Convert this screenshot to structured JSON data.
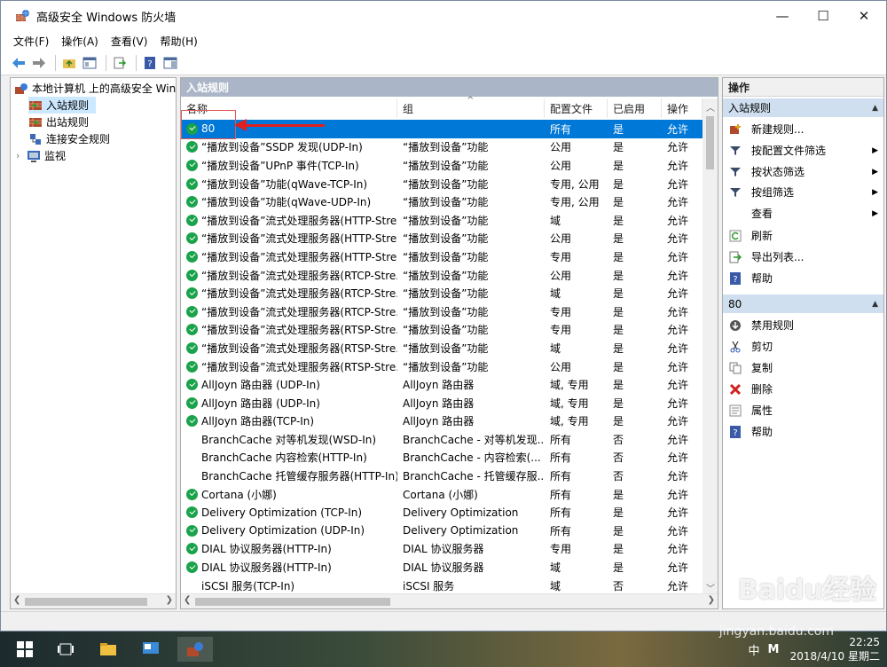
{
  "window": {
    "title": "高级安全 Windows 防火墙",
    "min": "—",
    "max": "☐",
    "close": "✕"
  },
  "menu": [
    "文件(F)",
    "操作(A)",
    "查看(V)",
    "帮助(H)"
  ],
  "tree": {
    "root": "本地计算机 上的高级安全 Windows",
    "items": [
      "入站规则",
      "出站规则",
      "连接安全规则",
      "监视"
    ]
  },
  "center": {
    "header": "入站规则",
    "columns": [
      "名称",
      "组",
      "配置文件",
      "已启用",
      "操作"
    ],
    "rows": [
      {
        "name": "80",
        "group": "",
        "profile": "所有",
        "enabled": "是",
        "action": "允许",
        "icon": "check",
        "selected": true
      },
      {
        "name": "“播放到设备”SSDP 发现(UDP-In)",
        "group": "“播放到设备”功能",
        "profile": "公用",
        "enabled": "是",
        "action": "允许",
        "icon": "check"
      },
      {
        "name": "“播放到设备”UPnP 事件(TCP-In)",
        "group": "“播放到设备”功能",
        "profile": "公用",
        "enabled": "是",
        "action": "允许",
        "icon": "check"
      },
      {
        "name": "“播放到设备”功能(qWave-TCP-In)",
        "group": "“播放到设备”功能",
        "profile": "专用, 公用",
        "enabled": "是",
        "action": "允许",
        "icon": "check"
      },
      {
        "name": "“播放到设备”功能(qWave-UDP-In)",
        "group": "“播放到设备”功能",
        "profile": "专用, 公用",
        "enabled": "是",
        "action": "允许",
        "icon": "check"
      },
      {
        "name": "“播放到设备”流式处理服务器(HTTP-Stre...",
        "group": "“播放到设备”功能",
        "profile": "域",
        "enabled": "是",
        "action": "允许",
        "icon": "check"
      },
      {
        "name": "“播放到设备”流式处理服务器(HTTP-Stre...",
        "group": "“播放到设备”功能",
        "profile": "公用",
        "enabled": "是",
        "action": "允许",
        "icon": "check"
      },
      {
        "name": "“播放到设备”流式处理服务器(HTTP-Stre...",
        "group": "“播放到设备”功能",
        "profile": "专用",
        "enabled": "是",
        "action": "允许",
        "icon": "check"
      },
      {
        "name": "“播放到设备”流式处理服务器(RTCP-Stre...",
        "group": "“播放到设备”功能",
        "profile": "公用",
        "enabled": "是",
        "action": "允许",
        "icon": "check"
      },
      {
        "name": "“播放到设备”流式处理服务器(RTCP-Stre...",
        "group": "“播放到设备”功能",
        "profile": "域",
        "enabled": "是",
        "action": "允许",
        "icon": "check"
      },
      {
        "name": "“播放到设备”流式处理服务器(RTCP-Stre...",
        "group": "“播放到设备”功能",
        "profile": "专用",
        "enabled": "是",
        "action": "允许",
        "icon": "check"
      },
      {
        "name": "“播放到设备”流式处理服务器(RTSP-Stre...",
        "group": "“播放到设备”功能",
        "profile": "专用",
        "enabled": "是",
        "action": "允许",
        "icon": "check"
      },
      {
        "name": "“播放到设备”流式处理服务器(RTSP-Stre...",
        "group": "“播放到设备”功能",
        "profile": "域",
        "enabled": "是",
        "action": "允许",
        "icon": "check"
      },
      {
        "name": "“播放到设备”流式处理服务器(RTSP-Stre...",
        "group": "“播放到设备”功能",
        "profile": "公用",
        "enabled": "是",
        "action": "允许",
        "icon": "check"
      },
      {
        "name": "AllJoyn 路由器 (UDP-In)",
        "group": "AllJoyn 路由器",
        "profile": "域, 专用",
        "enabled": "是",
        "action": "允许",
        "icon": "check"
      },
      {
        "name": "AllJoyn 路由器 (UDP-In)",
        "group": "AllJoyn 路由器",
        "profile": "域, 专用",
        "enabled": "是",
        "action": "允许",
        "icon": "check"
      },
      {
        "name": "AllJoyn 路由器(TCP-In)",
        "group": "AllJoyn 路由器",
        "profile": "域, 专用",
        "enabled": "是",
        "action": "允许",
        "icon": "check"
      },
      {
        "name": "BranchCache 对等机发现(WSD-In)",
        "group": "BranchCache - 对等机发现...",
        "profile": "所有",
        "enabled": "否",
        "action": "允许",
        "icon": "none"
      },
      {
        "name": "BranchCache 内容检索(HTTP-In)",
        "group": "BranchCache - 内容检索(...",
        "profile": "所有",
        "enabled": "否",
        "action": "允许",
        "icon": "none"
      },
      {
        "name": "BranchCache 托管缓存服务器(HTTP-In)",
        "group": "BranchCache - 托管缓存服...",
        "profile": "所有",
        "enabled": "否",
        "action": "允许",
        "icon": "none"
      },
      {
        "name": "Cortana (小娜)",
        "group": "Cortana (小娜)",
        "profile": "所有",
        "enabled": "是",
        "action": "允许",
        "icon": "check"
      },
      {
        "name": "Delivery Optimization (TCP-In)",
        "group": "Delivery Optimization",
        "profile": "所有",
        "enabled": "是",
        "action": "允许",
        "icon": "check"
      },
      {
        "name": "Delivery Optimization (UDP-In)",
        "group": "Delivery Optimization",
        "profile": "所有",
        "enabled": "是",
        "action": "允许",
        "icon": "check"
      },
      {
        "name": "DIAL 协议服务器(HTTP-In)",
        "group": "DIAL 协议服务器",
        "profile": "专用",
        "enabled": "是",
        "action": "允许",
        "icon": "check"
      },
      {
        "name": "DIAL 协议服务器(HTTP-In)",
        "group": "DIAL 协议服务器",
        "profile": "域",
        "enabled": "是",
        "action": "允许",
        "icon": "check"
      },
      {
        "name": "iSCSI 服务(TCP-In)",
        "group": "iSCSI 服务",
        "profile": "域",
        "enabled": "否",
        "action": "允许",
        "icon": "none"
      }
    ]
  },
  "actions": {
    "header": "操作",
    "section1": "入站规则",
    "section1_items": [
      "新建规则...",
      "按配置文件筛选",
      "按状态筛选",
      "按组筛选",
      "查看",
      "刷新",
      "导出列表...",
      "帮助"
    ],
    "section2": "80",
    "section2_items": [
      "禁用规则",
      "剪切",
      "复制",
      "删除",
      "属性",
      "帮助"
    ]
  },
  "taskbar": {
    "time": "22:25",
    "date": "2018/4/10 星期二",
    "ime": "中",
    "lang": "M"
  },
  "watermark": {
    "brand": "Baidu经验",
    "url": "jingyan.baidu.com"
  },
  "colors": {
    "accent": "#0078d7",
    "check": "#1aa34a",
    "pane_header": "#aab6c7"
  }
}
